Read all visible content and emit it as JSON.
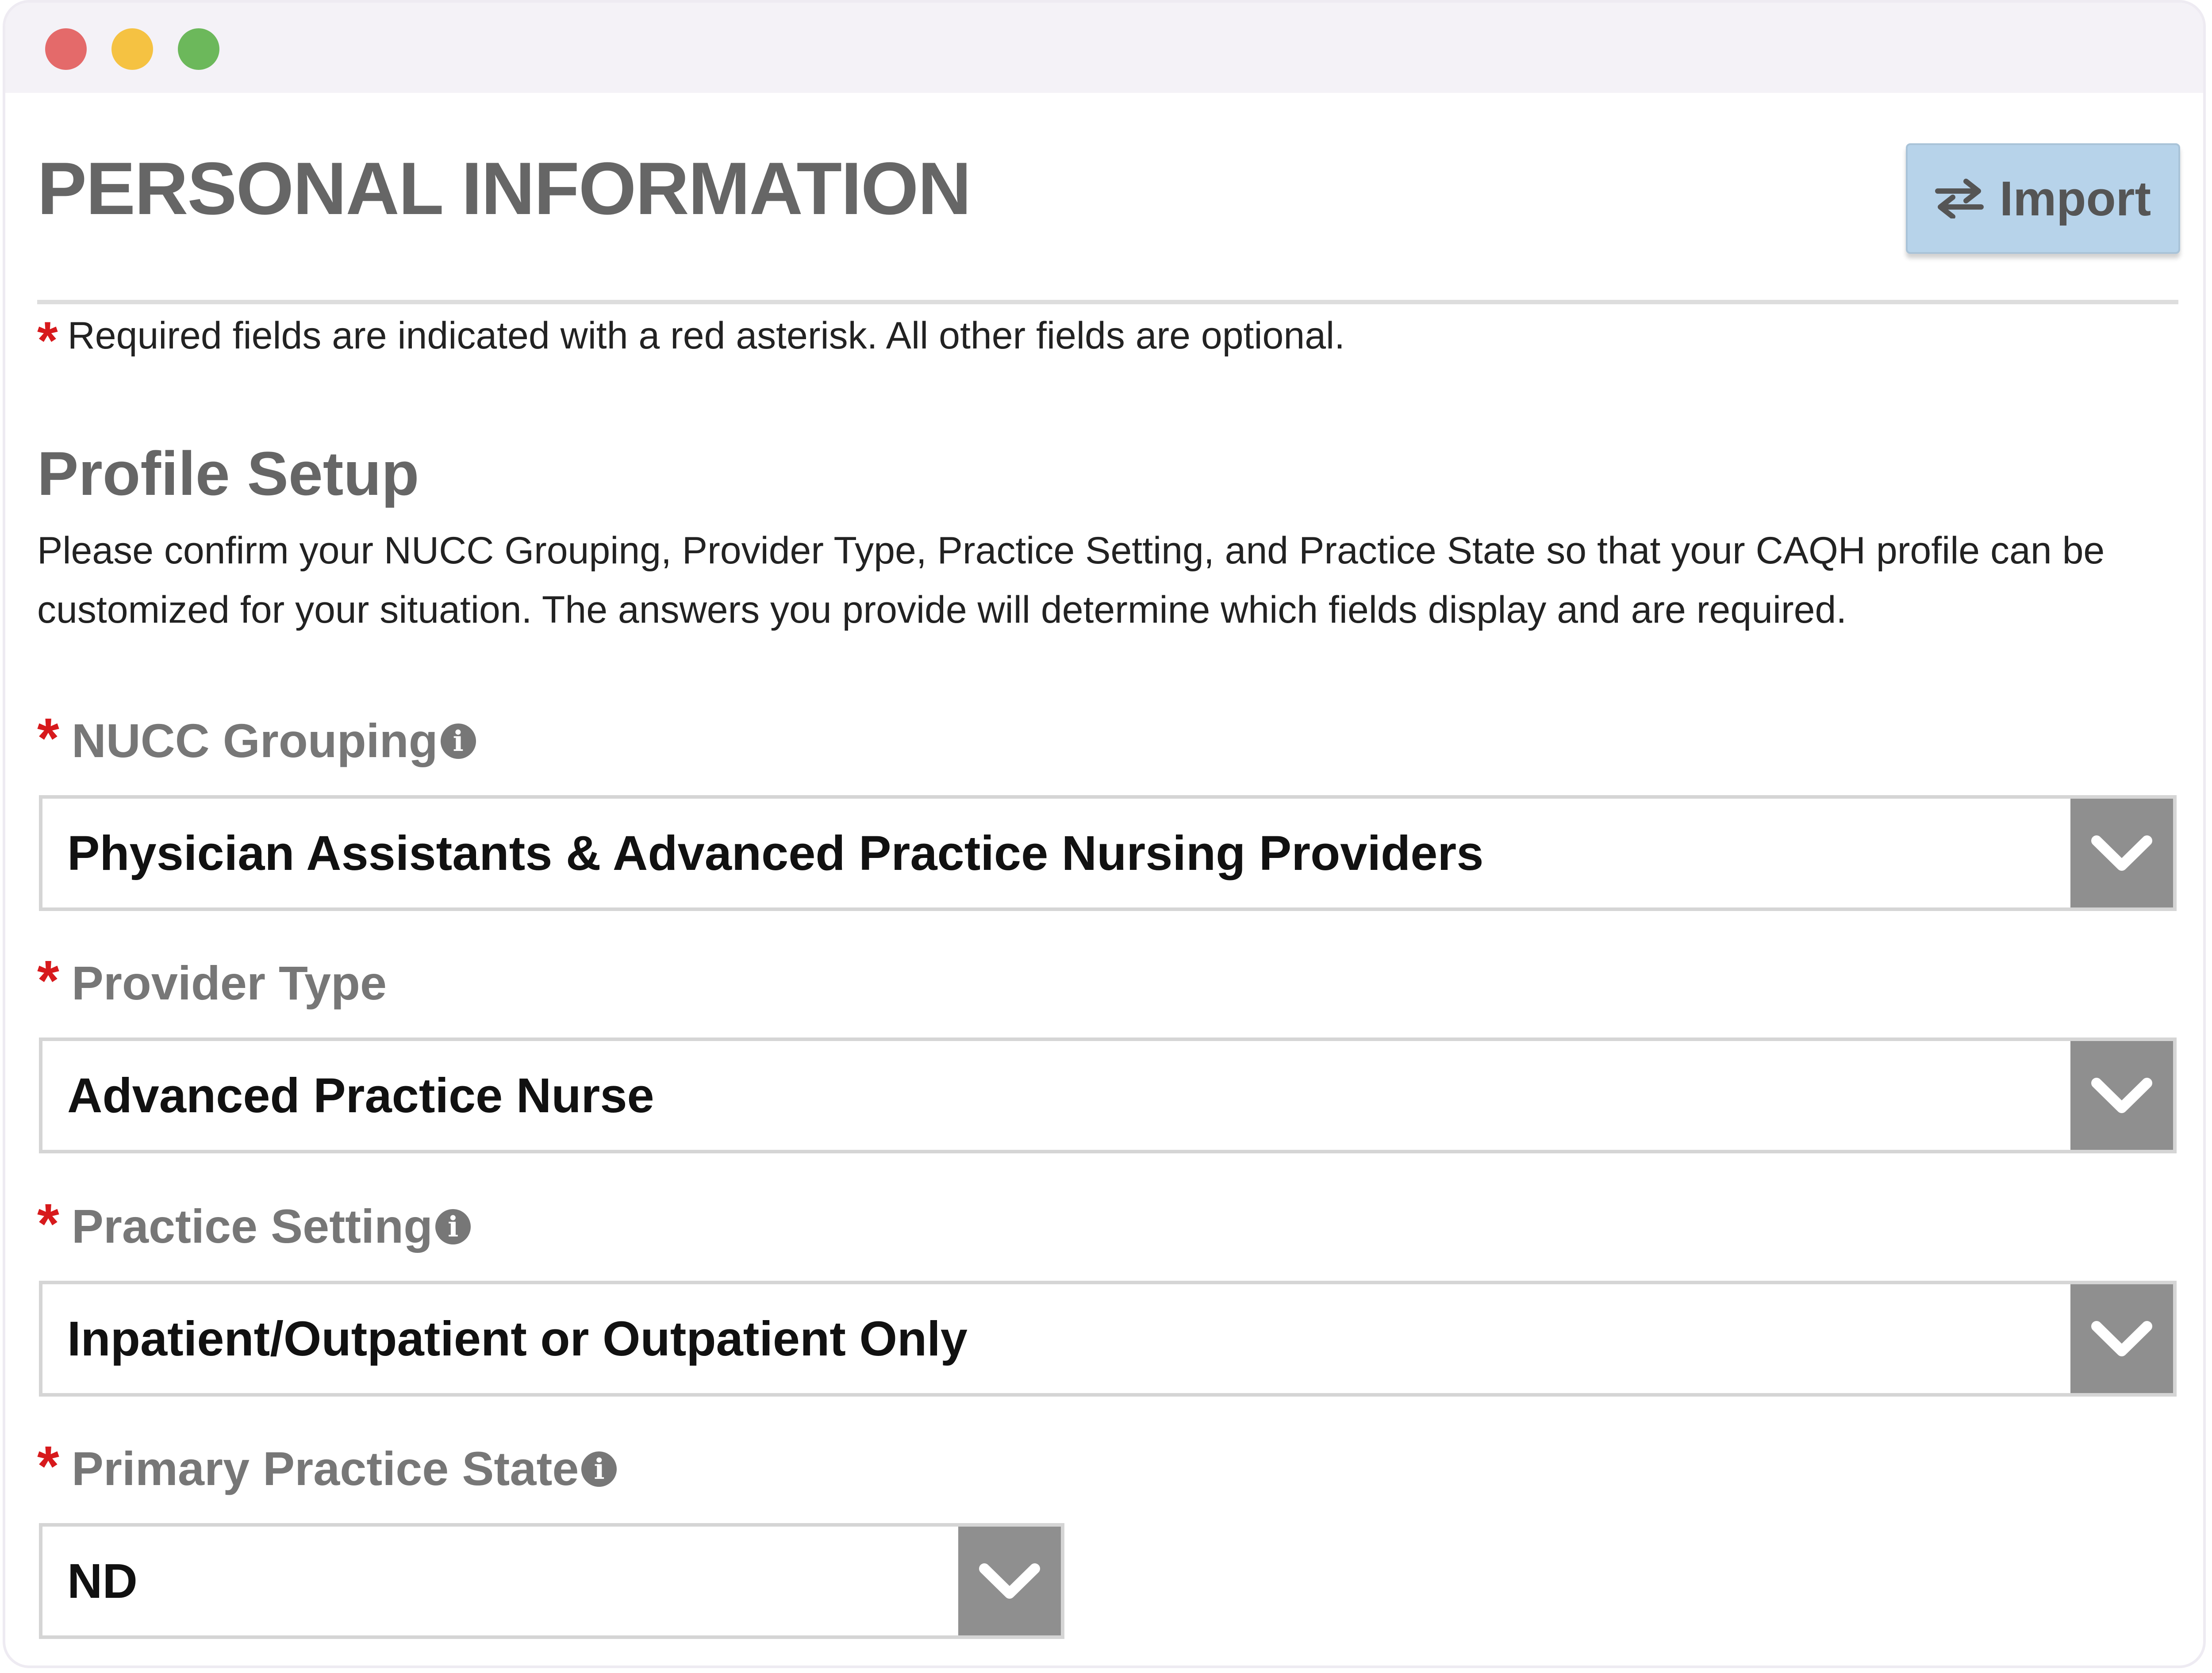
{
  "header": {
    "title": "PERSONAL INFORMATION",
    "import_label": "Import"
  },
  "required_note": {
    "asterisk": "*",
    "text": "Required fields are indicated with a red asterisk. All other fields are optional."
  },
  "profile_setup": {
    "title": "Profile Setup",
    "description": "Please confirm your NUCC Grouping, Provider Type, Practice Setting, and Practice State so that your CAQH profile can be customized for your situation. The answers you provide will determine which fields display and are required."
  },
  "fields": [
    {
      "label": "NUCC Grouping",
      "has_info": true,
      "value": "Physician Assistants & Advanced Practice Nursing Providers"
    },
    {
      "label": "Provider Type",
      "has_info": false,
      "value": "Advanced Practice Nurse"
    },
    {
      "label": "Practice Setting",
      "has_info": true,
      "value": "Inpatient/Outpatient or Outpatient Only"
    },
    {
      "label": "Primary Practice State",
      "has_info": true,
      "value": "ND"
    }
  ],
  "colors": {
    "asterisk": "#d7191c",
    "import_button_bg": "#b7d3ea",
    "dropdown_caret_bg": "#8f8f8f",
    "label_gray": "#777777"
  },
  "icons": {
    "import": "swap-arrows-icon",
    "info": "info-icon",
    "dropdown": "chevron-down-icon"
  }
}
